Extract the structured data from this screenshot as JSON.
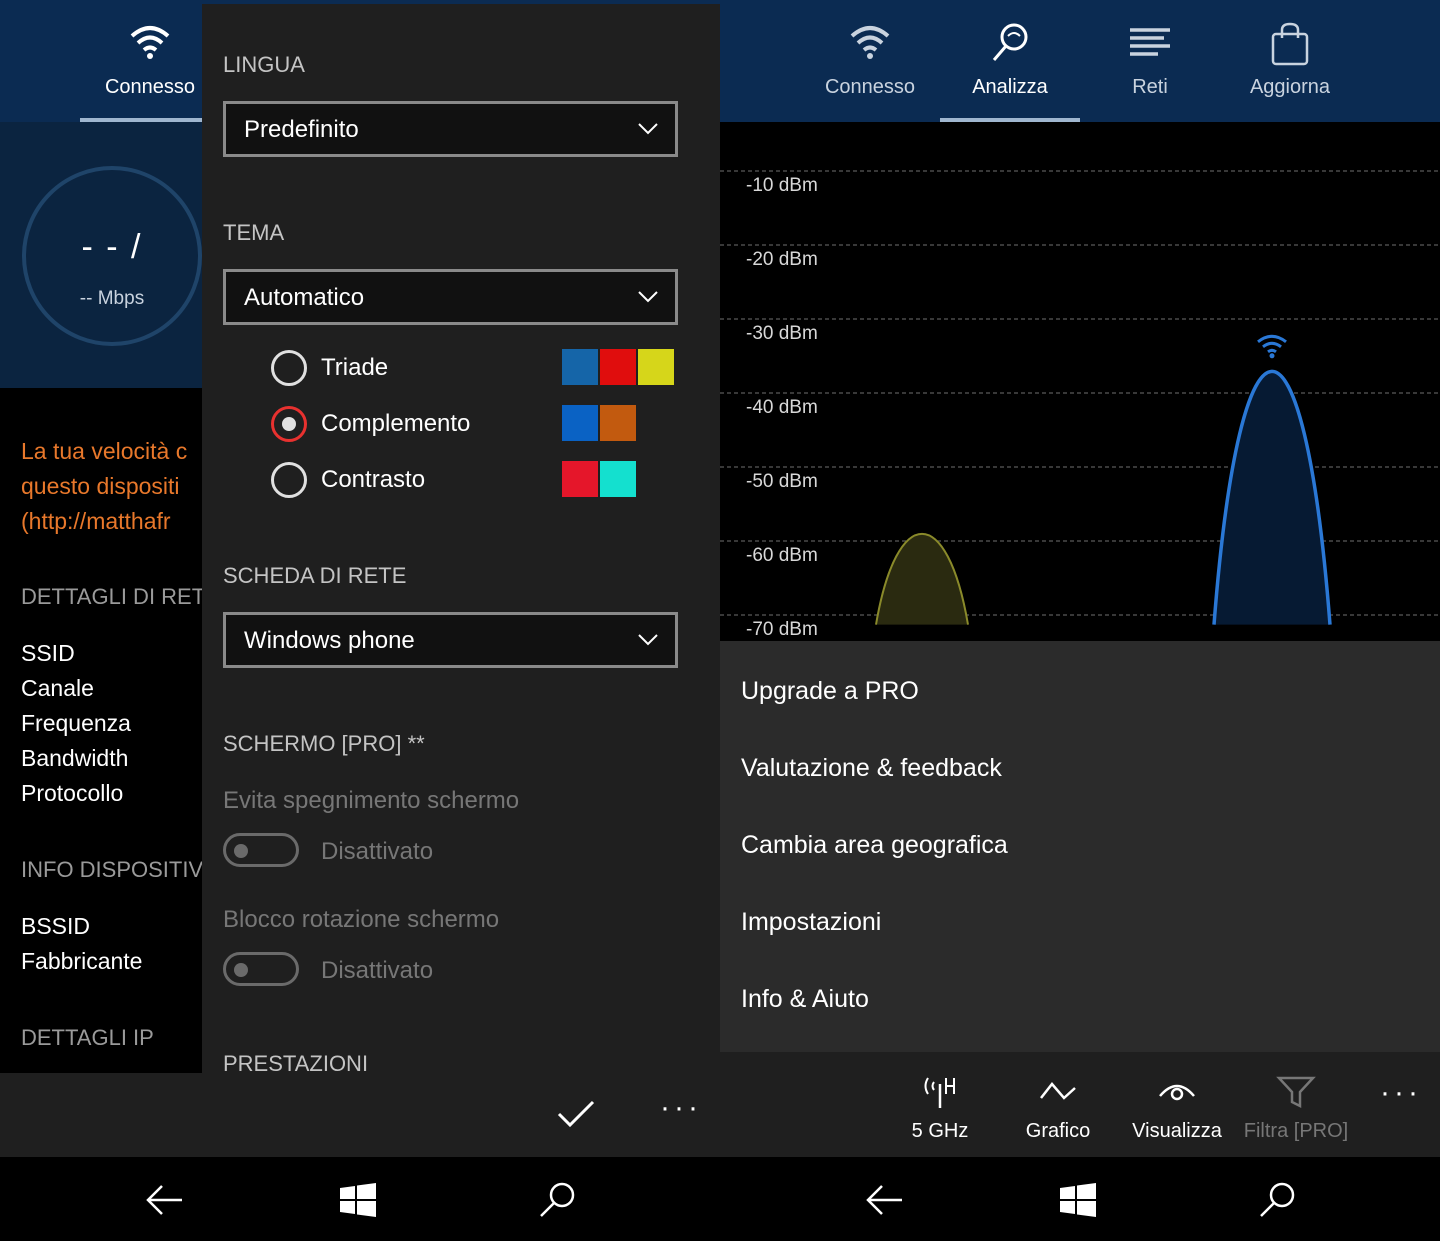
{
  "left": {
    "tab": {
      "label": "Connesso",
      "icon": "wifi-icon"
    },
    "gauge": {
      "value": "- - /",
      "unit": "-- Mbps"
    },
    "warning": [
      "La tua velocità c",
      "questo dispositi",
      "(http://matthafr"
    ],
    "sections": {
      "net_details": "DETTAGLI DI RET",
      "device_info": "INFO DISPOSITIV",
      "ip_details": "DETTAGLI IP"
    },
    "net_items": [
      "SSID",
      "Canale",
      "Frequenza",
      "Bandwidth",
      "Protocollo"
    ],
    "device_items": [
      "BSSID",
      "Fabbricante"
    ],
    "settings": {
      "language_label": "LINGUA",
      "language_value": "Predefinito",
      "theme_label": "TEMA",
      "theme_value": "Automatico",
      "themes": [
        {
          "label": "Triade",
          "selected": false,
          "colors": [
            "#1565a8",
            "#e00d0d",
            "#d6d61a"
          ]
        },
        {
          "label": "Complemento",
          "selected": true,
          "colors": [
            "#0a62c4",
            "#c25a0f"
          ]
        },
        {
          "label": "Contrasto",
          "selected": false,
          "colors": [
            "#e5162a",
            "#14e0cf"
          ]
        }
      ],
      "adapter_label": "SCHEDA DI RETE",
      "adapter_value": "Windows phone",
      "screen_label": "SCHERMO [PRO] **",
      "screen_off_label": "Evita spegnimento schermo",
      "screen_off_state": "Disattivato",
      "rotation_label": "Blocco rotazione schermo",
      "rotation_state": "Disattivato",
      "performance_label": "PRESTAZIONI"
    }
  },
  "right": {
    "tabs": [
      {
        "label": "Connesso",
        "icon": "wifi-icon"
      },
      {
        "label": "Analizza",
        "icon": "magnifier-icon"
      },
      {
        "label": "Reti",
        "icon": "list-icon"
      },
      {
        "label": "Aggiorna",
        "icon": "bag-icon"
      }
    ],
    "active_tab": "Analizza",
    "menu": [
      "Upgrade a PRO",
      "Valutazione & feedback",
      "Cambia area geografica",
      "Impostazioni",
      "Info & Aiuto"
    ],
    "appbar": [
      {
        "label": "5 GHz",
        "icon": "antenna-icon",
        "disabled": false
      },
      {
        "label": "Grafico",
        "icon": "chart-line-icon",
        "disabled": false
      },
      {
        "label": "Visualizza",
        "icon": "eye-icon",
        "disabled": false
      },
      {
        "label": "Filtra [PRO]",
        "icon": "filter-icon",
        "disabled": true
      }
    ]
  },
  "chart_data": {
    "type": "area",
    "title": "",
    "xlabel": "",
    "ylabel": "",
    "y_tick_labels": [
      "-10 dBm",
      "-20 dBm",
      "-30 dBm",
      "-40 dBm",
      "-50 dBm",
      "-60 dBm",
      "-70 dBm"
    ],
    "y_ticks": [
      -10,
      -20,
      -30,
      -40,
      -50,
      -60,
      -70
    ],
    "ylim": [
      -72,
      -3
    ],
    "grid": true,
    "series": [
      {
        "color": "#8a8a2a",
        "fill": "#2a2a10",
        "peak_dbm": -59,
        "wifi_marker": false
      },
      {
        "color": "#2a78d6",
        "fill": "#061a33",
        "peak_dbm": -37,
        "wifi_marker": true
      }
    ]
  },
  "colors": {
    "header": "#0b2b52",
    "accent": "#e8312f",
    "warning": "#e8782b"
  }
}
